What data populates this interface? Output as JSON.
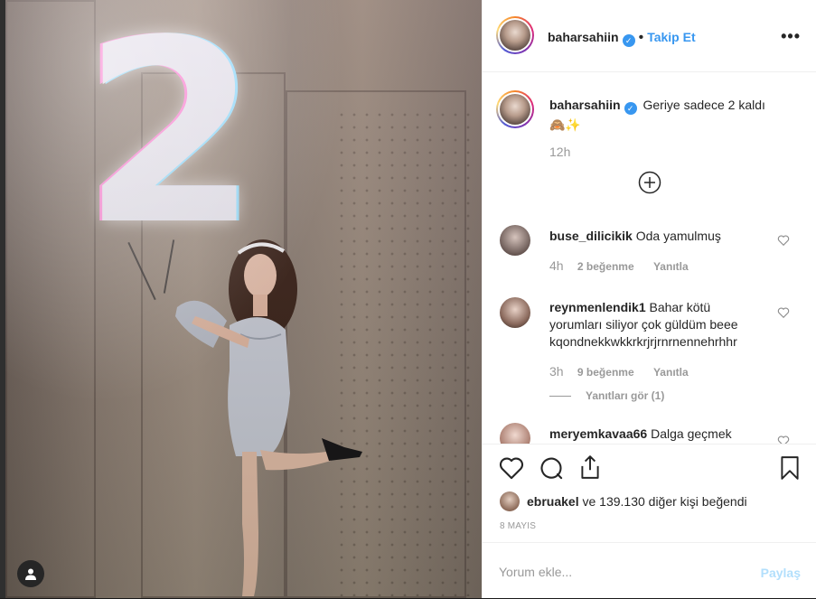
{
  "post": {
    "username": "baharsahiin",
    "follow_label": "Takip Et",
    "more_label": "•••",
    "caption": "Geriye sadece 2 kaldı",
    "caption_emoji": "🙈✨",
    "caption_time": "12h",
    "balloon_digit": "2"
  },
  "comments": [
    {
      "user": "buse_dilicikik",
      "text": [
        "Oda yamulmuş"
      ],
      "time": "4h",
      "likes": "2 beğenme",
      "reply": "Yanıtla"
    },
    {
      "user": "reynmenlendik1",
      "text": [
        "Bahar kötü",
        "yorumları siliyor çok güldüm beee",
        "kqondnekkwkkrkrjrjrnrnennehrhhr"
      ],
      "time": "3h",
      "likes": "9 beğenme",
      "reply": "Yanıtla",
      "view_replies": "Yanıtları gör (1)"
    },
    {
      "user": "meryemkavaa66",
      "text": [
        "Dalga geçmek"
      ]
    }
  ],
  "likes": {
    "user": "ebruakel",
    "rest": "ve 139.130 diğer kişi beğendi"
  },
  "date": "8 MAYIS",
  "add_comment": {
    "placeholder": "Yorum ekle...",
    "post_label": "Paylaş"
  },
  "icons": {
    "heart": "heart-icon",
    "comment": "comment-icon",
    "share": "share-icon",
    "bookmark": "bookmark-icon",
    "add": "plus-circle-icon",
    "user": "user-icon"
  },
  "colors": {
    "link": "#3897f0",
    "verified": "#3897f0",
    "post_disabled": "#b2dffc"
  }
}
